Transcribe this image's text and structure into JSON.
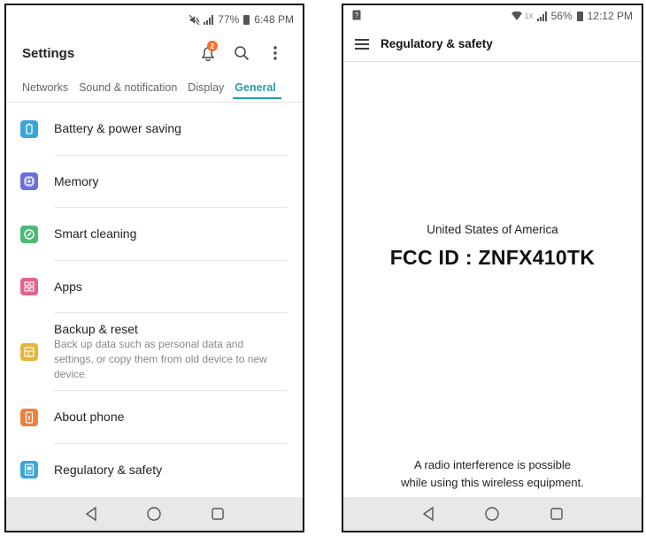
{
  "left_screen": {
    "status": {
      "battery": "77%",
      "time": "6:48 PM"
    },
    "header": {
      "title": "Settings",
      "notification_count": "2"
    },
    "tabs": [
      {
        "label": "Networks",
        "active": false
      },
      {
        "label": "Sound & notification",
        "active": false
      },
      {
        "label": "Display",
        "active": false
      },
      {
        "label": "General",
        "active": true
      }
    ],
    "items": [
      {
        "label": "Battery & power saving",
        "icon": "battery-icon",
        "color": "#3aa5d9"
      },
      {
        "label": "Memory",
        "icon": "memory-chip-icon",
        "color": "#6b6fd6"
      },
      {
        "label": "Smart cleaning",
        "icon": "smart-cleaning-icon",
        "color": "#4dbb73"
      },
      {
        "label": "Apps",
        "icon": "apps-icon",
        "color": "#e0648a"
      },
      {
        "label": "Backup & reset",
        "description": "Back up data such as personal data and settings, or copy them from old device to new device",
        "icon": "backup-icon",
        "color": "#e5b43a"
      },
      {
        "label": "About phone",
        "icon": "about-phone-icon",
        "color": "#ee7f3f"
      },
      {
        "label": "Regulatory & safety",
        "icon": "regulatory-icon",
        "color": "#3aa5d9"
      }
    ]
  },
  "right_screen": {
    "status": {
      "battery": "56%",
      "time": "12:12 PM",
      "network": "1X"
    },
    "header": {
      "title": "Regulatory & safety"
    },
    "country": "United States of America",
    "fcc_id": "FCC ID : ZNFX410TK",
    "note_line1": "A radio interference is possible",
    "note_line2": "while using this wireless equipment."
  }
}
